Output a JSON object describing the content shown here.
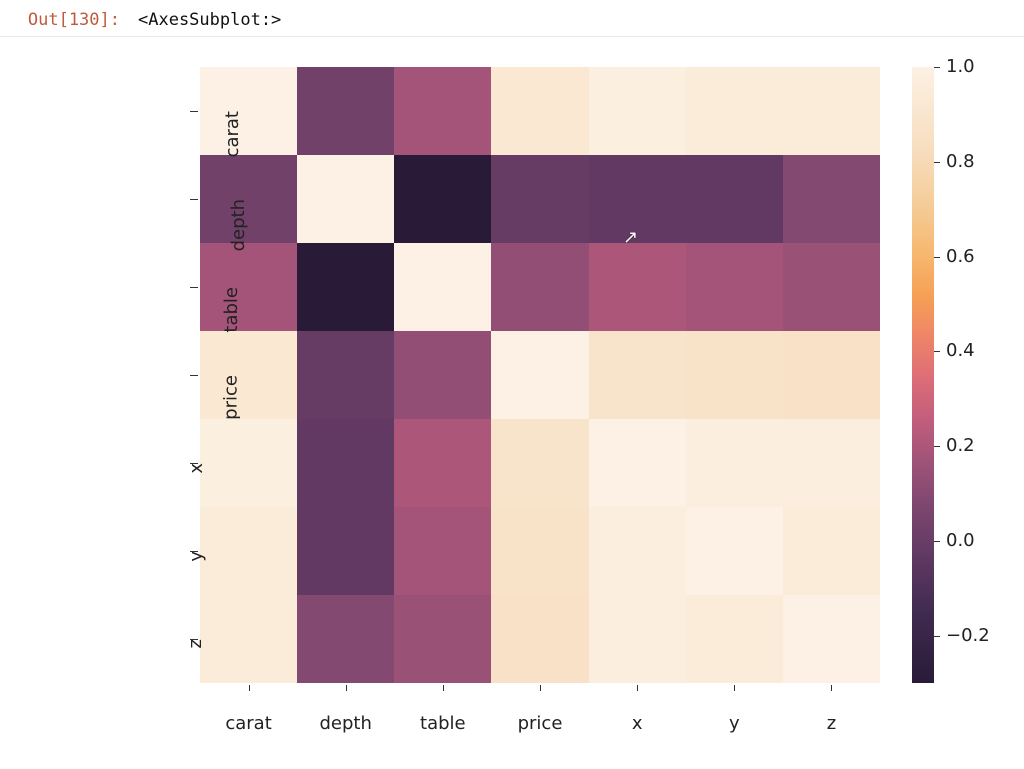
{
  "prompt_label": "Out[130]:",
  "repr_text": "<AxesSubplot:>",
  "chart_data": {
    "type": "heatmap",
    "categories": [
      "carat",
      "depth",
      "table",
      "price",
      "x",
      "y",
      "z"
    ],
    "xlabel": "",
    "ylabel": "",
    "cbar_lim": [
      -0.3,
      1.0
    ],
    "cbar_ticks": [
      1.0,
      0.8,
      0.6,
      0.4,
      0.2,
      0.0,
      -0.2
    ],
    "cbar_tick_labels": [
      "1.0",
      "0.8",
      "0.6",
      "0.4",
      "0.2",
      "0.0",
      "−0.2"
    ],
    "matrix": [
      [
        1.0,
        0.03,
        0.18,
        0.92,
        0.98,
        0.95,
        0.95
      ],
      [
        0.03,
        1.0,
        -0.3,
        -0.01,
        -0.03,
        -0.03,
        0.09
      ],
      [
        0.18,
        -0.3,
        1.0,
        0.13,
        0.2,
        0.18,
        0.15
      ],
      [
        0.92,
        -0.01,
        0.13,
        1.0,
        0.88,
        0.87,
        0.86
      ],
      [
        0.98,
        -0.03,
        0.2,
        0.88,
        1.0,
        0.97,
        0.97
      ],
      [
        0.95,
        -0.03,
        0.18,
        0.87,
        0.97,
        1.0,
        0.95
      ],
      [
        0.95,
        0.09,
        0.15,
        0.86,
        0.97,
        0.95,
        1.0
      ]
    ]
  },
  "cursor": {
    "x_frac": 0.625,
    "y_frac": 0.283,
    "glyph": "↖"
  }
}
